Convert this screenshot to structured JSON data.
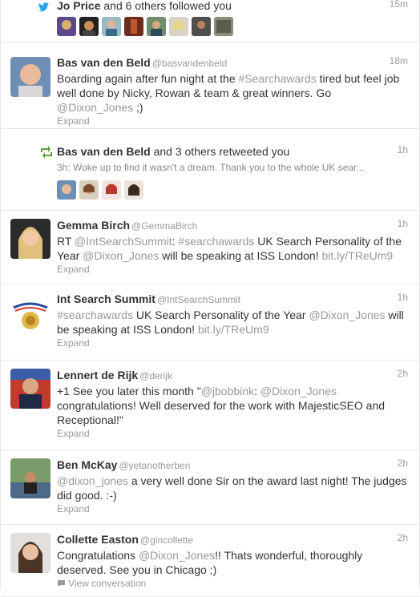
{
  "items": [
    {
      "type": "follow",
      "name": "Jo Price",
      "rest": "and 6 others followed you",
      "time": "15m"
    },
    {
      "type": "tweet",
      "name": "Bas van den Beld",
      "handle": "@basvandenbeld",
      "time": "18m",
      "text": [
        {
          "t": "Boarding again after fun night at the "
        },
        {
          "t": "#Searchawards",
          "link": true
        },
        {
          "t": " tired but feel job well done by Nicky, Rowan & team & great winners. Go "
        },
        {
          "t": "@Dixon_Jones",
          "link": true
        },
        {
          "t": " ;)"
        }
      ],
      "footer": "Expand"
    },
    {
      "type": "retweet",
      "name": "Bas van den Beld",
      "rest": "and 3 others retweeted you",
      "time": "1h",
      "sub": "3h: Woke up to find it wasn't a dream. Thank you to the whole UK sear..."
    },
    {
      "type": "tweet",
      "name": "Gemma Birch",
      "handle": "@GemmaBirch",
      "time": "1h",
      "text": [
        {
          "t": "RT "
        },
        {
          "t": "@IntSearchSummit",
          "link": true
        },
        {
          "t": ": "
        },
        {
          "t": "#searchawards",
          "link": true
        },
        {
          "t": " UK Search Personality of the Year "
        },
        {
          "t": "@Dixon_Jones",
          "link": true
        },
        {
          "t": " will be speaking at ISS London! "
        },
        {
          "t": "bit.ly/TReUm9",
          "link": true
        }
      ],
      "footer": "Expand"
    },
    {
      "type": "tweet",
      "name": "Int Search Summit",
      "handle": "@IntSearchSummit",
      "time": "1h",
      "text": [
        {
          "t": "#searchawards",
          "link": true
        },
        {
          "t": " UK Search Personality of the Year "
        },
        {
          "t": "@Dixon_Jones",
          "link": true
        },
        {
          "t": " will be speaking at ISS London! "
        },
        {
          "t": "bit.ly/TReUm9",
          "link": true
        }
      ],
      "footer": "Expand"
    },
    {
      "type": "tweet",
      "name": "Lennert de Rijk",
      "handle": "@derijk",
      "time": "2h",
      "text": [
        {
          "t": "+1 See you later this month \""
        },
        {
          "t": "@jbobbink",
          "link": true
        },
        {
          "t": ": "
        },
        {
          "t": "@Dixon_Jones",
          "link": true
        },
        {
          "t": " congratulations! Well deserved for the work with MajesticSEO and Receptional!\""
        }
      ],
      "footer": "Expand"
    },
    {
      "type": "tweet",
      "name": "Ben McKay",
      "handle": "@yetanotherben",
      "time": "2h",
      "text": [
        {
          "t": "@dixon_jones",
          "link": true
        },
        {
          "t": " a very well done Sir on the award last night! The judges did good. :-)"
        }
      ],
      "footer": "Expand"
    },
    {
      "type": "tweet",
      "name": "Collette Easton",
      "handle": "@gincollette",
      "time": "2h",
      "text": [
        {
          "t": "Congratulations "
        },
        {
          "t": "@Dixon_Jones",
          "link": true
        },
        {
          "t": "!! Thats wonderful, thoroughly deserved. See you in Chicago ;)"
        }
      ],
      "footer": "View conversation"
    }
  ]
}
